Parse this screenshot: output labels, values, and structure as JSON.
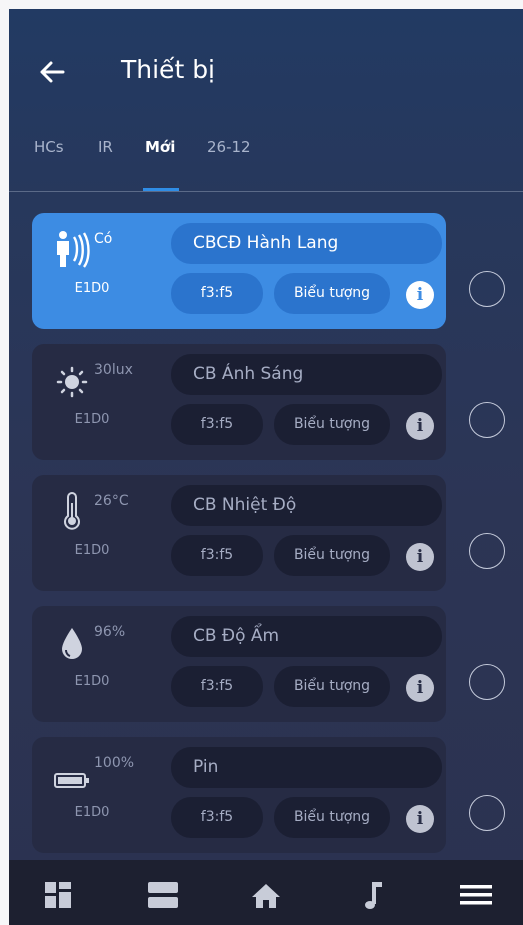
{
  "header": {
    "title": "Thiết bị"
  },
  "tabs": [
    {
      "label": "HCs",
      "active": false
    },
    {
      "label": "IR",
      "active": false
    },
    {
      "label": "Mới",
      "active": true
    },
    {
      "label": "26-12",
      "active": false
    }
  ],
  "devices": [
    {
      "icon": "motion-sensor-icon",
      "value": "Có",
      "code": "E1D0",
      "name": "CBCĐ Hành Lang",
      "address": "f3:f5",
      "icon_label": "Biểu tượng",
      "selected": true,
      "selectable": false
    },
    {
      "icon": "sun-icon",
      "value": "30lux",
      "code": "E1D0",
      "name": "CB Ánh Sáng",
      "address": "f3:f5",
      "icon_label": "Biểu tượng",
      "selected": false,
      "selectable": false
    },
    {
      "icon": "thermometer-icon",
      "value": "26°C",
      "code": "E1D0",
      "name": "CB Nhiệt Độ",
      "address": "f3:f5",
      "icon_label": "Biểu tượng",
      "selected": false,
      "selectable": false
    },
    {
      "icon": "water-drop-icon",
      "value": "96%",
      "code": "E1D0",
      "name": "CB Độ Ẩm",
      "address": "f3:f5",
      "icon_label": "Biểu tượng",
      "selected": false,
      "selectable": false
    },
    {
      "icon": "battery-icon",
      "value": "100%",
      "code": "E1D0",
      "name": "Pin",
      "address": "f3:f5",
      "icon_label": "Biểu tượng",
      "selected": false,
      "selectable": false
    }
  ],
  "info_glyph": "i",
  "bottom_nav": [
    {
      "icon": "dashboard-icon"
    },
    {
      "icon": "rooms-icon"
    },
    {
      "icon": "home-icon"
    },
    {
      "icon": "music-icon"
    },
    {
      "icon": "menu-icon"
    }
  ],
  "colors": {
    "accent": "#3d8ce3",
    "background": "#2b3250",
    "card": "#262b44",
    "nav_bar": "#1d2030"
  }
}
